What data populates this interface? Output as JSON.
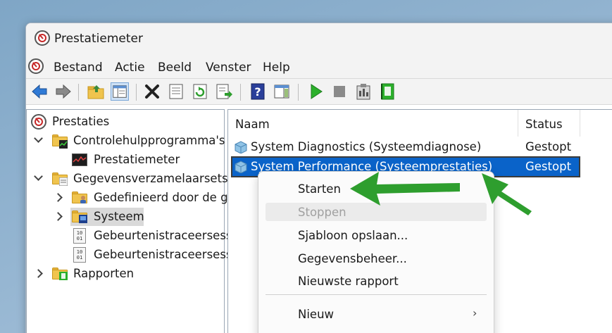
{
  "window": {
    "title": "Prestatiemeter"
  },
  "menu": [
    "Bestand",
    "Actie",
    "Beeld",
    "Venster",
    "Help"
  ],
  "toolbar_icons": [
    "back-arrow-icon",
    "forward-arrow-icon",
    "up-folder-icon",
    "show-hide-tree-icon",
    "delete-icon",
    "properties-icon",
    "refresh-icon",
    "export-list-icon",
    "help-icon",
    "show-hide-action-pane-icon",
    "start-icon",
    "stop-icon",
    "clipboard-icon",
    "notebook-icon"
  ],
  "tree": {
    "root": "Prestaties",
    "items": [
      {
        "label": "Controlehulpprogramma's",
        "level": 1,
        "expanded": true
      },
      {
        "label": "Prestatiemeter",
        "level": 2
      },
      {
        "label": "Gegevensverzamelaarsets",
        "level": 1,
        "expanded": true
      },
      {
        "label": "Gedefinieerd door de g",
        "level": 2,
        "expanded": false
      },
      {
        "label": "Systeem",
        "level": 2,
        "expanded": false,
        "selected": true
      },
      {
        "label": "Gebeurtenistraceersessi",
        "level": 2
      },
      {
        "label": "Gebeurtenistraceersessi",
        "level": 2
      },
      {
        "label": "Rapporten",
        "level": 1,
        "expanded": false
      }
    ]
  },
  "table": {
    "columns": [
      "Naam",
      "Status"
    ],
    "rows": [
      {
        "name": "System Diagnostics (Systeemdiagnose)",
        "status": "Gestopt"
      },
      {
        "name": "System Performance (Systeemprestaties)",
        "status": "Gestopt",
        "selected": true
      }
    ]
  },
  "context_menu": {
    "items": [
      {
        "label": "Starten",
        "enabled": true
      },
      {
        "label": "Stoppen",
        "enabled": false
      },
      {
        "label": "Sjabloon opslaan...",
        "enabled": true
      },
      {
        "label": "Gegevensbeheer...",
        "enabled": true
      },
      {
        "label": "Nieuwste rapport",
        "enabled": true
      },
      {
        "label": "Nieuw",
        "enabled": true,
        "submenu": true
      }
    ]
  },
  "colors": {
    "selection": "#0a63c9",
    "annotation_arrow": "#2e9e2e",
    "folder": "#f0c44e"
  }
}
